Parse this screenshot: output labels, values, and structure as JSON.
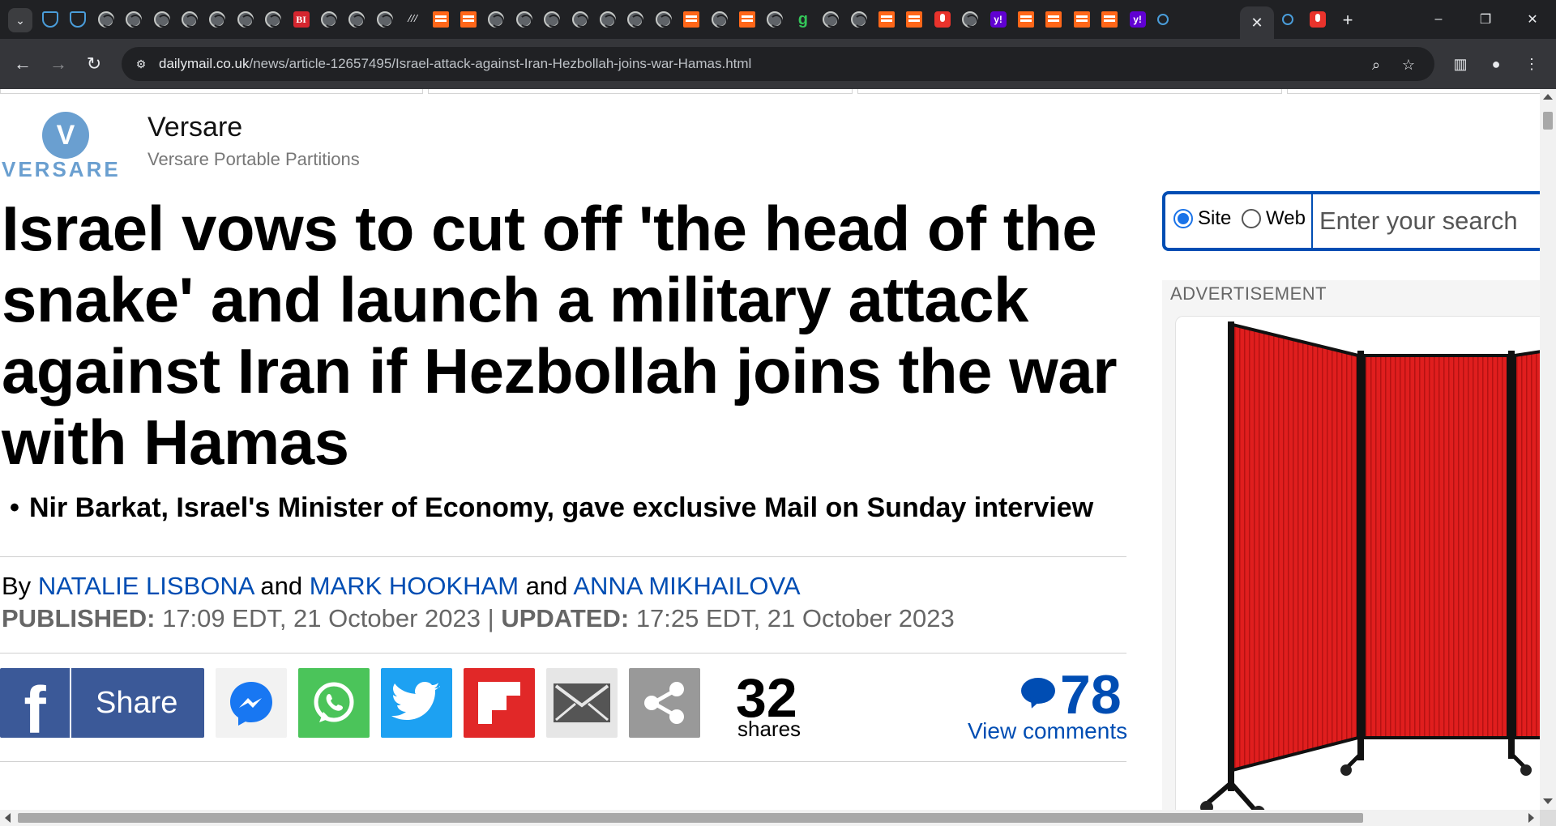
{
  "browser": {
    "tab_count_icons": [
      "shield",
      "shield",
      "globe",
      "globe",
      "globe",
      "globe",
      "globe",
      "globe",
      "globe",
      "bi",
      "globe",
      "globe",
      "globe",
      "nyt",
      "substack",
      "substack",
      "globe",
      "globe",
      "globe",
      "globe",
      "globe",
      "globe",
      "globe",
      "substack",
      "globe",
      "substack",
      "globe",
      "g",
      "globe",
      "globe",
      "substack",
      "substack",
      "mic",
      "globe",
      "yahoo",
      "substack",
      "substack",
      "substack",
      "substack",
      "yahoo",
      "search"
    ],
    "active_tab_close": "✕",
    "after_active_icons": [
      "search",
      "mic"
    ],
    "new_tab": "+",
    "window_controls": {
      "minimize": "–",
      "restore": "❐",
      "close": "✕"
    },
    "url_domain": "dailymail.co.uk",
    "url_path": "/news/article-12657495/Israel-attack-against-Iran-Hezbollah-joins-war-Hamas.html"
  },
  "sponsor": {
    "logo_letter": "V",
    "logo_word": "VERSARE",
    "name": "Versare",
    "tagline": "Versare Portable Partitions"
  },
  "article": {
    "headline": "Israel vows to cut off 'the head of the snake' and launch a military attack against Iran if Hezbollah joins the war with Hamas",
    "bullet": "Nir Barkat, Israel's Minister of Economy, gave exclusive Mail on Sunday interview",
    "byline": {
      "by": "By",
      "and": "and",
      "authors": [
        "NATALIE LISBONA",
        "MARK HOOKHAM",
        "ANNA MIKHAILOVA"
      ]
    },
    "published_label": "PUBLISHED:",
    "published_value": "17:09 EDT, 21 October 2023",
    "separator": "|",
    "updated_label": "UPDATED:",
    "updated_value": "17:25 EDT, 21 October 2023"
  },
  "share": {
    "facebook_letter": "f",
    "facebook_label": "Share",
    "count": "32",
    "count_label": "shares",
    "comments_count": "78",
    "comments_label": "View comments"
  },
  "search": {
    "option_site": "Site",
    "option_web": "Web",
    "selected": "Site",
    "placeholder": "Enter your search"
  },
  "ad": {
    "label": "ADVERTISEMENT"
  },
  "colors": {
    "link_blue": "#004db3",
    "facebook": "#3b5998",
    "whatsapp": "#4bc45a",
    "twitter": "#1da1f2",
    "flipboard": "#e12828",
    "partition_red": "#e01e1e"
  }
}
